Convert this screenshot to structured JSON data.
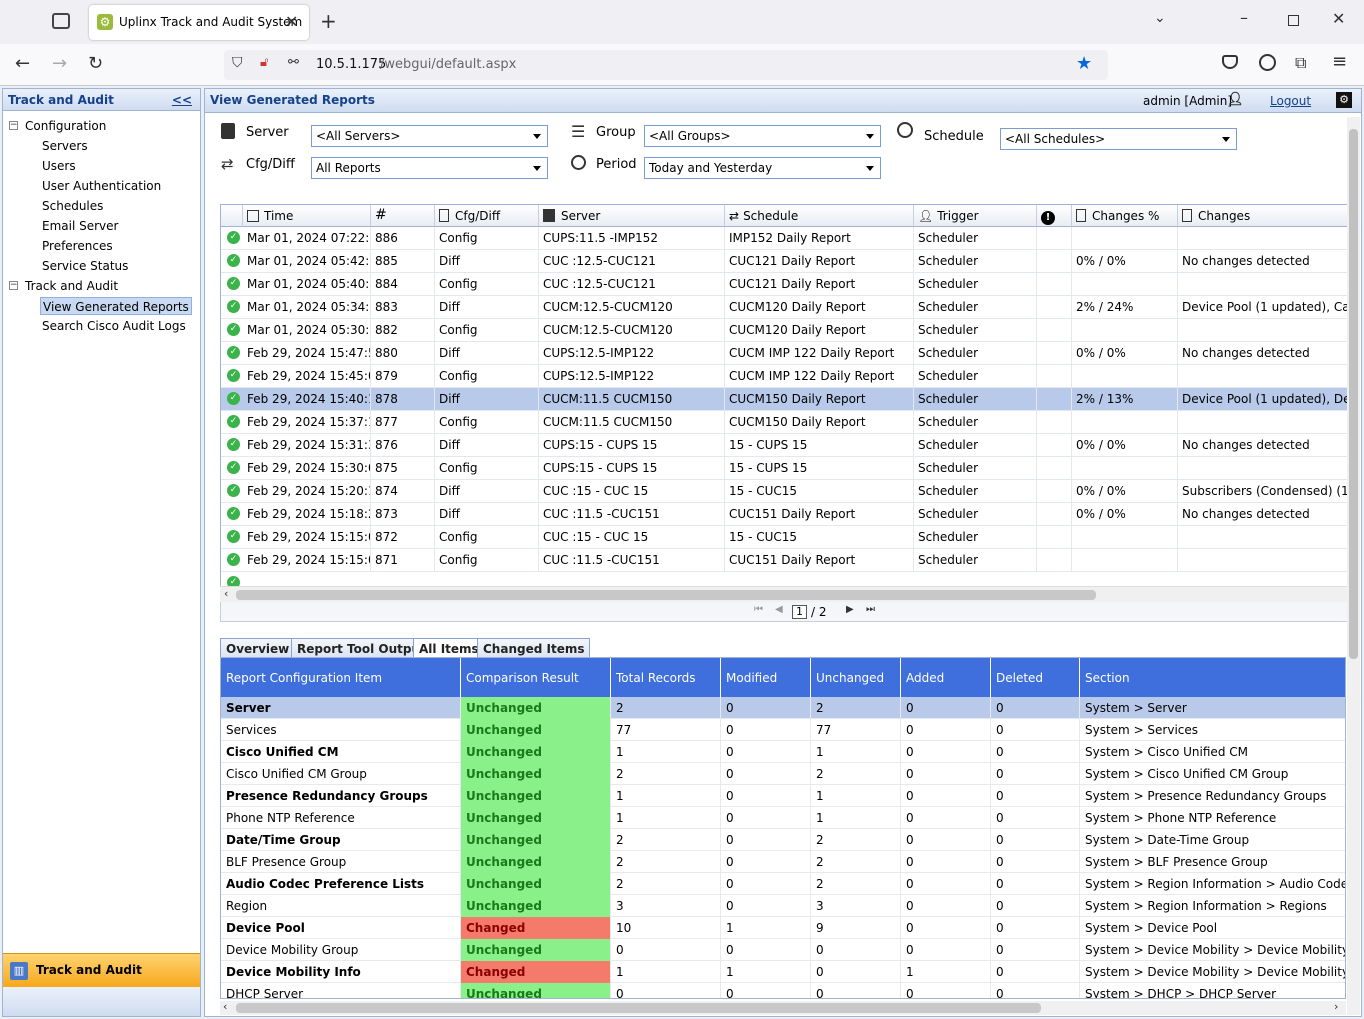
{
  "browser": {
    "tab_title": "Uplinx Track and Audit System",
    "url_host": "10.5.1.175",
    "url_path": "/webgui/default.aspx"
  },
  "left": {
    "title": "Track and Audit",
    "collapse": "<<",
    "tree": {
      "configuration": "Configuration",
      "servers": "Servers",
      "users": "Users",
      "user_auth": "User Authentication",
      "schedules": "Schedules",
      "email_server": "Email Server",
      "preferences": "Preferences",
      "service_status": "Service Status",
      "track_audit": "Track and Audit",
      "view_reports": "View Generated Reports",
      "search_logs": "Search Cisco Audit Logs"
    },
    "bottom_label": "Track and Audit"
  },
  "main": {
    "title": "View Generated Reports",
    "user": "admin  [Admin]",
    "logout": "Logout"
  },
  "filters": {
    "server_label": "Server",
    "server_value": "<All Servers>",
    "group_label": "Group",
    "group_value": "<All Groups>",
    "schedule_label": "Schedule",
    "schedule_value": "<All Schedules>",
    "cfg_label": "Cfg/Diff",
    "cfg_value": "All Reports",
    "period_label": "Period",
    "period_value": "Today and Yesterday"
  },
  "grid": {
    "headers": [
      "Time",
      "#",
      "Cfg/Diff",
      "Server",
      "Schedule",
      "Trigger",
      "",
      "Changes %",
      "Changes"
    ],
    "rows": [
      [
        "Mar 01, 2024 07:22:14",
        "886",
        "Config",
        "CUPS:11.5 -IMP152",
        "IMP152 Daily Report",
        "Scheduler",
        "",
        "",
        ""
      ],
      [
        "Mar 01, 2024 05:42:24",
        "885",
        "Diff",
        "CUC :12.5-CUC121",
        "CUC121 Daily Report",
        "Scheduler",
        "",
        "0% / 0%",
        "No changes detected"
      ],
      [
        "Mar 01, 2024 05:40:10",
        "884",
        "Config",
        "CUC :12.5-CUC121",
        "CUC121 Daily Report",
        "Scheduler",
        "",
        "",
        ""
      ],
      [
        "Mar 01, 2024 05:34:09",
        "883",
        "Diff",
        "CUCM:12.5-CUCM120",
        "CUCM120 Daily Report",
        "Scheduler",
        "",
        "2% / 24%",
        "Device Pool (1 updated), Callin"
      ],
      [
        "Mar 01, 2024 05:30:16",
        "882",
        "Config",
        "CUCM:12.5-CUCM120",
        "CUCM120 Daily Report",
        "Scheduler",
        "",
        "",
        ""
      ],
      [
        "Feb 29, 2024 15:47:58",
        "880",
        "Diff",
        "CUPS:12.5-IMP122",
        "CUCM IMP 122  Daily Report",
        "Scheduler",
        "",
        "0% / 0%",
        "No changes detected"
      ],
      [
        "Feb 29, 2024 15:45:05",
        "879",
        "Config",
        "CUPS:12.5-IMP122",
        "CUCM IMP 122  Daily Report",
        "Scheduler",
        "",
        "",
        ""
      ],
      [
        "Feb 29, 2024 15:40:11",
        "878",
        "Diff",
        "CUCM:11.5 CUCM150",
        "CUCM150 Daily Report",
        "Scheduler",
        "",
        "2% / 13%",
        "Device Pool (1 updated), Device"
      ],
      [
        "Feb 29, 2024 15:37:17",
        "877",
        "Config",
        "CUCM:11.5 CUCM150",
        "CUCM150 Daily Report",
        "Scheduler",
        "",
        "",
        ""
      ],
      [
        "Feb 29, 2024 15:31:32",
        "876",
        "Diff",
        "CUPS:15 - CUPS 15",
        "15 - CUPS 15",
        "Scheduler",
        "",
        "0% / 0%",
        "No changes detected"
      ],
      [
        "Feb 29, 2024 15:30:05",
        "875",
        "Config",
        "CUPS:15 - CUPS 15",
        "15 - CUPS 15",
        "Scheduler",
        "",
        "",
        ""
      ],
      [
        "Feb 29, 2024 15:20:18",
        "874",
        "Diff",
        "CUC :15 - CUC 15",
        "15 - CUC15",
        "Scheduler",
        "",
        "0% / 0%",
        "Subscribers (Condensed) (1 new"
      ],
      [
        "Feb 29, 2024 15:18:21",
        "873",
        "Diff",
        "CUC :11.5 -CUC151",
        "CUC151 Daily Report",
        "Scheduler",
        "",
        "0% / 0%",
        "No changes detected"
      ],
      [
        "Feb 29, 2024 15:15:04",
        "872",
        "Config",
        "CUC :15 - CUC 15",
        "15 - CUC15",
        "Scheduler",
        "",
        "",
        ""
      ],
      [
        "Feb 29, 2024 15:15:04",
        "871",
        "Config",
        "CUC :11.5 -CUC151",
        "CUC151 Daily Report",
        "Scheduler",
        "",
        "",
        ""
      ]
    ],
    "selected_index": 7,
    "pager": {
      "page": "1",
      "total": "/ 2"
    }
  },
  "tabs": [
    "Overview",
    "Report Tool Output",
    "All Items",
    "Changed Items"
  ],
  "items": {
    "headers": [
      "Report Configuration Item",
      "Comparison Result",
      "Total Records",
      "Modified",
      "Unchanged",
      "Added",
      "Deleted",
      "Section"
    ],
    "rows": [
      {
        "name": "Server",
        "bold": true,
        "result": "Unchanged",
        "total": "2",
        "mod": "0",
        "unch": "2",
        "add": "0",
        "del": "0",
        "section": "System > Server"
      },
      {
        "name": "Services",
        "bold": false,
        "result": "Unchanged",
        "total": "77",
        "mod": "0",
        "unch": "77",
        "add": "0",
        "del": "0",
        "section": "System > Services"
      },
      {
        "name": "Cisco Unified CM",
        "bold": true,
        "result": "Unchanged",
        "total": "1",
        "mod": "0",
        "unch": "1",
        "add": "0",
        "del": "0",
        "section": "System > Cisco Unified CM"
      },
      {
        "name": "Cisco Unified CM Group",
        "bold": false,
        "result": "Unchanged",
        "total": "2",
        "mod": "0",
        "unch": "2",
        "add": "0",
        "del": "0",
        "section": "System > Cisco Unified CM Group"
      },
      {
        "name": "Presence Redundancy Groups",
        "bold": true,
        "result": "Unchanged",
        "total": "1",
        "mod": "0",
        "unch": "1",
        "add": "0",
        "del": "0",
        "section": "System > Presence Redundancy Groups"
      },
      {
        "name": "Phone NTP Reference",
        "bold": false,
        "result": "Unchanged",
        "total": "1",
        "mod": "0",
        "unch": "1",
        "add": "0",
        "del": "0",
        "section": "System > Phone NTP Reference"
      },
      {
        "name": "Date/Time Group",
        "bold": true,
        "result": "Unchanged",
        "total": "2",
        "mod": "0",
        "unch": "2",
        "add": "0",
        "del": "0",
        "section": "System > Date-Time Group"
      },
      {
        "name": "BLF Presence Group",
        "bold": false,
        "result": "Unchanged",
        "total": "2",
        "mod": "0",
        "unch": "2",
        "add": "0",
        "del": "0",
        "section": "System > BLF Presence Group"
      },
      {
        "name": "Audio Codec Preference Lists",
        "bold": true,
        "result": "Unchanged",
        "total": "2",
        "mod": "0",
        "unch": "2",
        "add": "0",
        "del": "0",
        "section": "System > Region Information > Audio Codec Pre"
      },
      {
        "name": "Region",
        "bold": false,
        "result": "Unchanged",
        "total": "3",
        "mod": "0",
        "unch": "3",
        "add": "0",
        "del": "0",
        "section": "System > Region Information > Regions"
      },
      {
        "name": "Device Pool",
        "bold": true,
        "result": "Changed",
        "total": "10",
        "mod": "1",
        "unch": "9",
        "add": "0",
        "del": "0",
        "section": "System > Device Pool"
      },
      {
        "name": "Device Mobility Group",
        "bold": false,
        "result": "Unchanged",
        "total": "0",
        "mod": "0",
        "unch": "0",
        "add": "0",
        "del": "0",
        "section": "System > Device Mobility > Device Mobility Grou"
      },
      {
        "name": "Device Mobility Info",
        "bold": true,
        "result": "Changed",
        "total": "1",
        "mod": "1",
        "unch": "0",
        "add": "1",
        "del": "0",
        "section": "System > Device Mobility > Device Mobility Info"
      },
      {
        "name": "DHCP Server",
        "bold": false,
        "result": "Unchanged",
        "total": "0",
        "mod": "0",
        "unch": "0",
        "add": "0",
        "del": "0",
        "section": "System > DHCP > DHCP Server"
      }
    ]
  },
  "colors": {
    "unchanged": "#8af08a",
    "changed": "#f47b6b",
    "header": "#3e6fdc",
    "selected": "#b8c9ea"
  }
}
